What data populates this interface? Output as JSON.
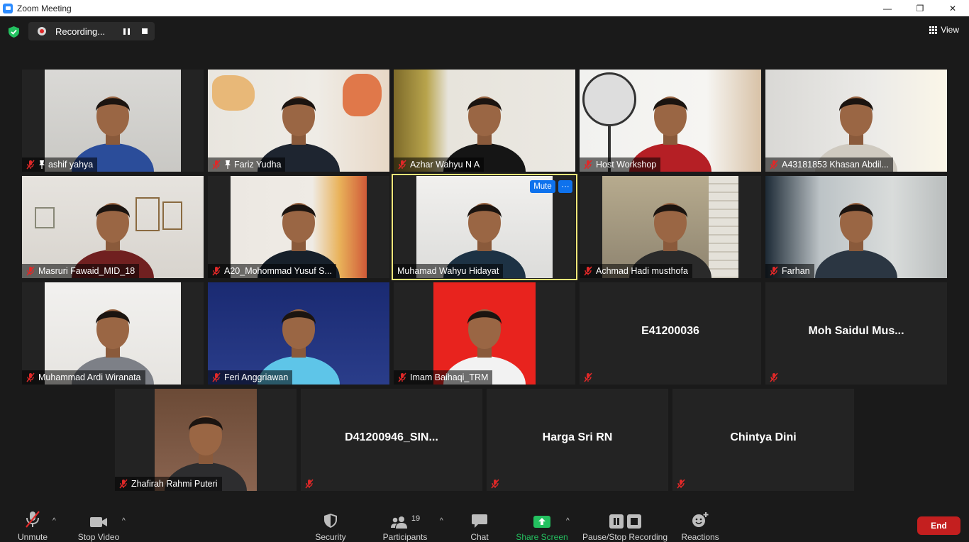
{
  "window": {
    "title": "Zoom Meeting",
    "minimize": "—",
    "restore": "❐",
    "close": "✕"
  },
  "topbar": {
    "recording_label": "Recording...",
    "view_label": "View"
  },
  "tiles": [
    {
      "name": "ashif yahya",
      "pinned": true
    },
    {
      "name": "Fariz Yudha",
      "pinned": true
    },
    {
      "name": "Azhar Wahyu N A"
    },
    {
      "name": "Host Workshop"
    },
    {
      "name": "A43181853 Khasan Abdil..."
    },
    {
      "name": "Masruri Fawaid_MID_18"
    },
    {
      "name": "A20_Mohommad Yusuf S..."
    },
    {
      "name": "Muhamad Wahyu Hidayat",
      "mute_label": "Mute",
      "more_label": "···"
    },
    {
      "name": "Achmad Hadi musthofa"
    },
    {
      "name": "Farhan"
    },
    {
      "name": "Muhammad Ardi Wiranata"
    },
    {
      "name": "Feri Anggriawan"
    },
    {
      "name": "Imam Baihaqi_TRM"
    },
    {
      "name": "E41200036"
    },
    {
      "name": "Moh Saidul Mus..."
    },
    {
      "name": "Zhafirah Rahmi Puteri"
    },
    {
      "name": "D41200946_SIN..."
    },
    {
      "name": "Harga Sri RN"
    },
    {
      "name": "Chintya Dini"
    }
  ],
  "toolbar": {
    "unmute": "Unmute",
    "stop_video": "Stop Video",
    "security": "Security",
    "participants": "Participants",
    "participants_count": "19",
    "chat": "Chat",
    "share_screen": "Share Screen",
    "pause_stop_recording": "Pause/Stop Recording",
    "reactions": "Reactions",
    "end": "End",
    "caret": "^"
  },
  "colors": {
    "share_green": "#24c160",
    "end_red": "#c41f1f",
    "active_speaker": "#f3e679",
    "mute_blue": "#0e72ed"
  }
}
